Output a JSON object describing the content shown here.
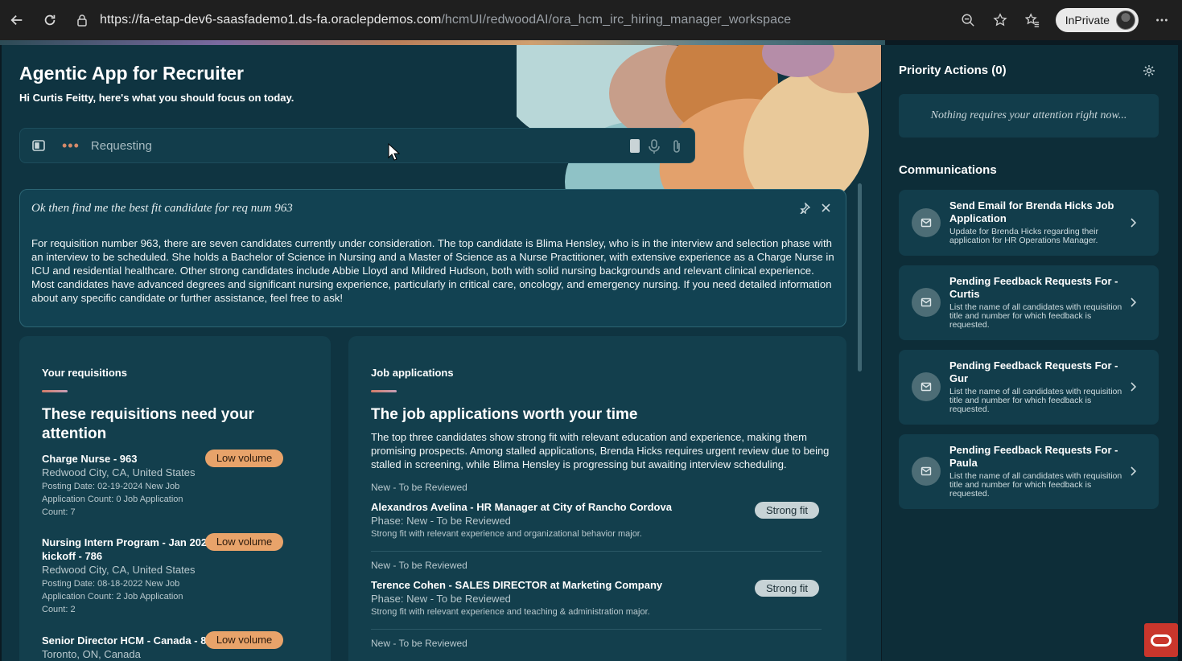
{
  "browser": {
    "url_host": "https://fa-etap-dev6-saasfademo1.ds-fa.oraclepdemos.com",
    "url_path": "/hcmUI/redwoodAI/ora_hcm_irc_hiring_manager_workspace",
    "profile_label": "InPrivate"
  },
  "header": {
    "title": "Agentic App for Recruiter",
    "subtitle": "Hi Curtis Feitty, here's what you should focus on today."
  },
  "prompt": {
    "status_text": "Requesting"
  },
  "answer": {
    "question": "Ok then find me the best fit candidate for req num 963",
    "body": "For requisition number 963, there are seven candidates currently under consideration. The top candidate is Blima Hensley, who is in the interview and selection phase with an interview to be scheduled. She holds a Bachelor of Science in Nursing and a Master of Science as a Nurse Practitioner, with extensive experience as a Charge Nurse in ICU and residential healthcare. Other strong candidates include Abbie Lloyd and Mildred Hudson, both with solid nursing backgrounds and relevant clinical experience. Most candidates have advanced degrees and significant nursing experience, particularly in critical care, oncology, and emergency nursing. If you need detailed information about any specific candidate or further assistance, feel free to ask!"
  },
  "requisitions": {
    "label": "Your requisitions",
    "heading": "These requisitions need your attention",
    "items": [
      {
        "title": "Charge Nurse - 963",
        "location": "Redwood City, CA, United States",
        "meta": "Posting Date: 02-19-2024 New Job Application Count: 0 Job Application Count: 7",
        "badge": "Low volume"
      },
      {
        "title": "Nursing Intern Program - Jan 2020 kickoff - 786",
        "location": "Redwood City, CA, United States",
        "meta": "Posting Date: 08-18-2022 New Job Application Count: 2 Job Application Count: 2",
        "badge": "Low volume"
      },
      {
        "title": "Senior Director HCM - Canada - 884",
        "location": "Toronto, ON, Canada",
        "meta": "",
        "badge": "Low volume"
      }
    ]
  },
  "applications": {
    "label": "Job applications",
    "heading": "The job applications worth your time",
    "description": "The top three candidates show strong fit with relevant education and experience, making them promising prospects. Among stalled applications, Brenda Hicks requires urgent review due to being stalled in screening, while Blima Hensley is progressing but awaiting interview scheduling.",
    "items": [
      {
        "status": "New - To be Reviewed",
        "name": "Alexandros Avelina - HR Manager at City of Rancho Cordova",
        "phase": "Phase: New - To be Reviewed",
        "note": "Strong fit with relevant experience and organizational behavior major.",
        "badge": "Strong fit"
      },
      {
        "status": "New - To be Reviewed",
        "name": "Terence Cohen - SALES DIRECTOR at Marketing Company",
        "phase": "Phase: New - To be Reviewed",
        "note": "Strong fit with relevant experience and teaching & administration major.",
        "badge": "Strong fit"
      },
      {
        "status": "New - To be Reviewed"
      }
    ]
  },
  "sidebar": {
    "priority_title": "Priority Actions (0)",
    "priority_empty": "Nothing requires your attention right now...",
    "communications_title": "Communications",
    "items": [
      {
        "title": "Send Email for Brenda Hicks Job Application",
        "desc": "Update for Brenda Hicks regarding their application for HR Operations Manager."
      },
      {
        "title": "Pending Feedback Requests For - Curtis",
        "desc": "List the name of all candidates with requisition title and number for which feedback is requested."
      },
      {
        "title": "Pending Feedback Requests For - Gur",
        "desc": "List the name of all candidates with requisition title and number for which feedback is requested."
      },
      {
        "title": "Pending Feedback Requests For - Paula",
        "desc": "List the name of all candidates with requisition title and number for which feedback is requested."
      }
    ]
  },
  "colors": {
    "app_background": "#0f3441",
    "panel": "#133f4d",
    "low_volume_badge": "#e8a36a",
    "strong_fit_badge": "#c7d3d6",
    "oracle_red": "#c9362c"
  },
  "icons": [
    "back-arrow-icon",
    "refresh-icon",
    "lock-icon",
    "zoom-out-icon",
    "star-icon",
    "favorites-icon",
    "more-icon",
    "panel-icon",
    "stop-icon",
    "mic-icon",
    "paperclip-icon",
    "pin-icon",
    "close-icon",
    "gear-icon",
    "mail-icon",
    "chevron-right-icon",
    "oracle-chat-icon"
  ]
}
